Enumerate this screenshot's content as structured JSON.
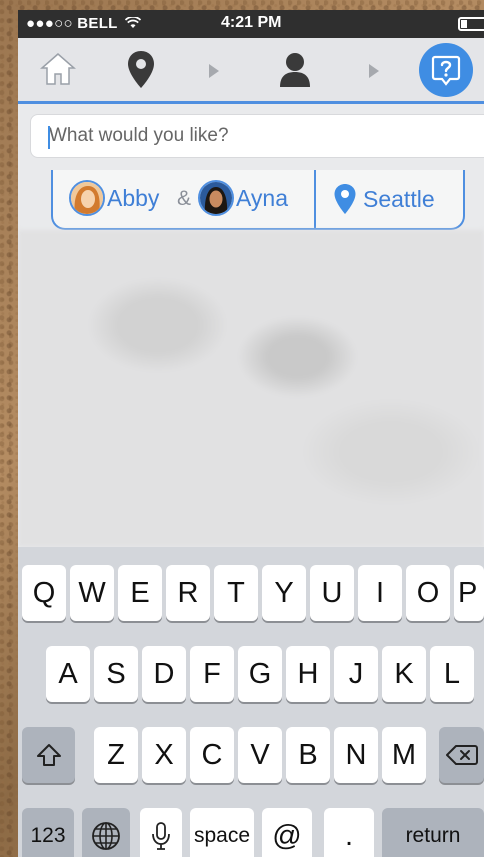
{
  "status_bar": {
    "carrier": "●●●○○ BELL",
    "time": "4:21 PM"
  },
  "nav": {
    "icons": [
      "home-icon",
      "location-pin-icon",
      "chevron-right-icon",
      "person-icon",
      "chevron-right-icon",
      "help-icon"
    ],
    "accent_color": "#3f8de3"
  },
  "search": {
    "placeholder": "What would you like?"
  },
  "context": {
    "person1": "Abby",
    "amp": "&",
    "person2": "Ayna",
    "city": "Seattle"
  },
  "keyboard": {
    "row1": [
      "Q",
      "W",
      "E",
      "R",
      "T",
      "Y",
      "U",
      "I",
      "O",
      "P"
    ],
    "row2": [
      "A",
      "S",
      "D",
      "F",
      "G",
      "H",
      "J",
      "K",
      "L"
    ],
    "row3": [
      "Z",
      "X",
      "C",
      "V",
      "B",
      "N",
      "M"
    ],
    "num_label": "123",
    "space_label": "space",
    "at_label": "@",
    "dot_label": ".",
    "return_label": "return"
  }
}
